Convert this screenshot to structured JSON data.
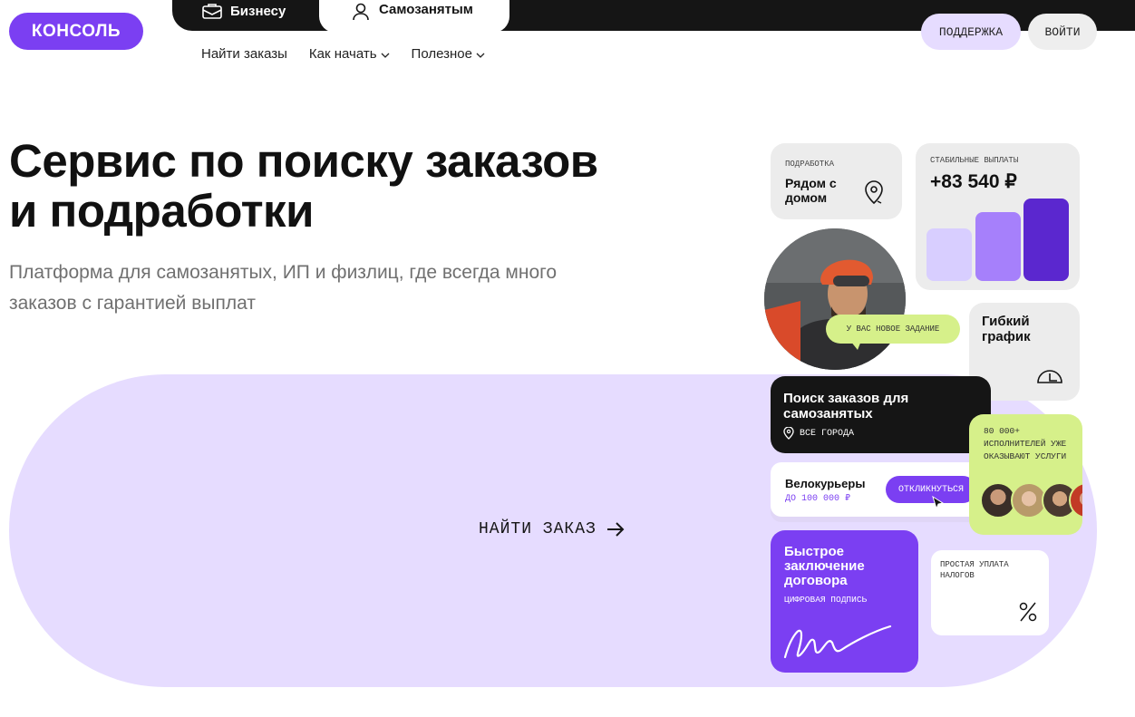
{
  "header": {
    "logo": "КОНСОЛЬ",
    "tabs": {
      "business": "Бизнесу",
      "self_employed": "Самозанятым"
    },
    "nav": [
      {
        "label": "Найти заказы"
      },
      {
        "label": "Как начать"
      },
      {
        "label": "Полезное"
      }
    ],
    "support_label": "ПОДДЕРЖКА",
    "login_label": "ВОЙТИ"
  },
  "hero": {
    "title_line1": "Сервис по поиску заказов",
    "title_line2": "и подработки",
    "subtitle_line1": "Платформа для самозанятых, ИП и физлиц, где всегда много",
    "subtitle_line2": "заказов с гарантией выплат",
    "cta_label": "НАЙТИ ЗАКАЗ"
  },
  "cards": {
    "near": {
      "label": "ПОДРАБОТКА",
      "title": "Рядом с домом"
    },
    "payouts": {
      "label": "СТАБИЛЬНЫЕ ВЫПЛАТЫ",
      "amount": "+83 540 ₽"
    },
    "notification": "У ВАС НОВОЕ ЗАДАНИЕ",
    "flex": {
      "title_line1": "Гибкий",
      "title_line2": "график"
    },
    "search": {
      "title": "Поиск заказов для самозанятых",
      "location": "ВСЕ ГОРОДА"
    },
    "courier": {
      "title": "Велокурьеры",
      "price": "ДО 100 000 ₽",
      "respond": "ОТКЛИКНУТЬСЯ"
    },
    "executors": {
      "text": "80 000+ ИСПОЛНИТЕЛЕЙ УЖЕ ОКАЗЫВАЮТ УСЛУГИ"
    },
    "contract": {
      "title": "Быстрое заключение договора",
      "subtitle": "ЦИФРОВАЯ ПОДПИСЬ"
    },
    "tax": {
      "label": "ПРОСТАЯ УПЛАТА НАЛОГОВ"
    }
  },
  "colors": {
    "brand": "#7b3ff2",
    "lavender": "#e6dcff",
    "lime": "#d6f08a",
    "dark": "#151515"
  }
}
